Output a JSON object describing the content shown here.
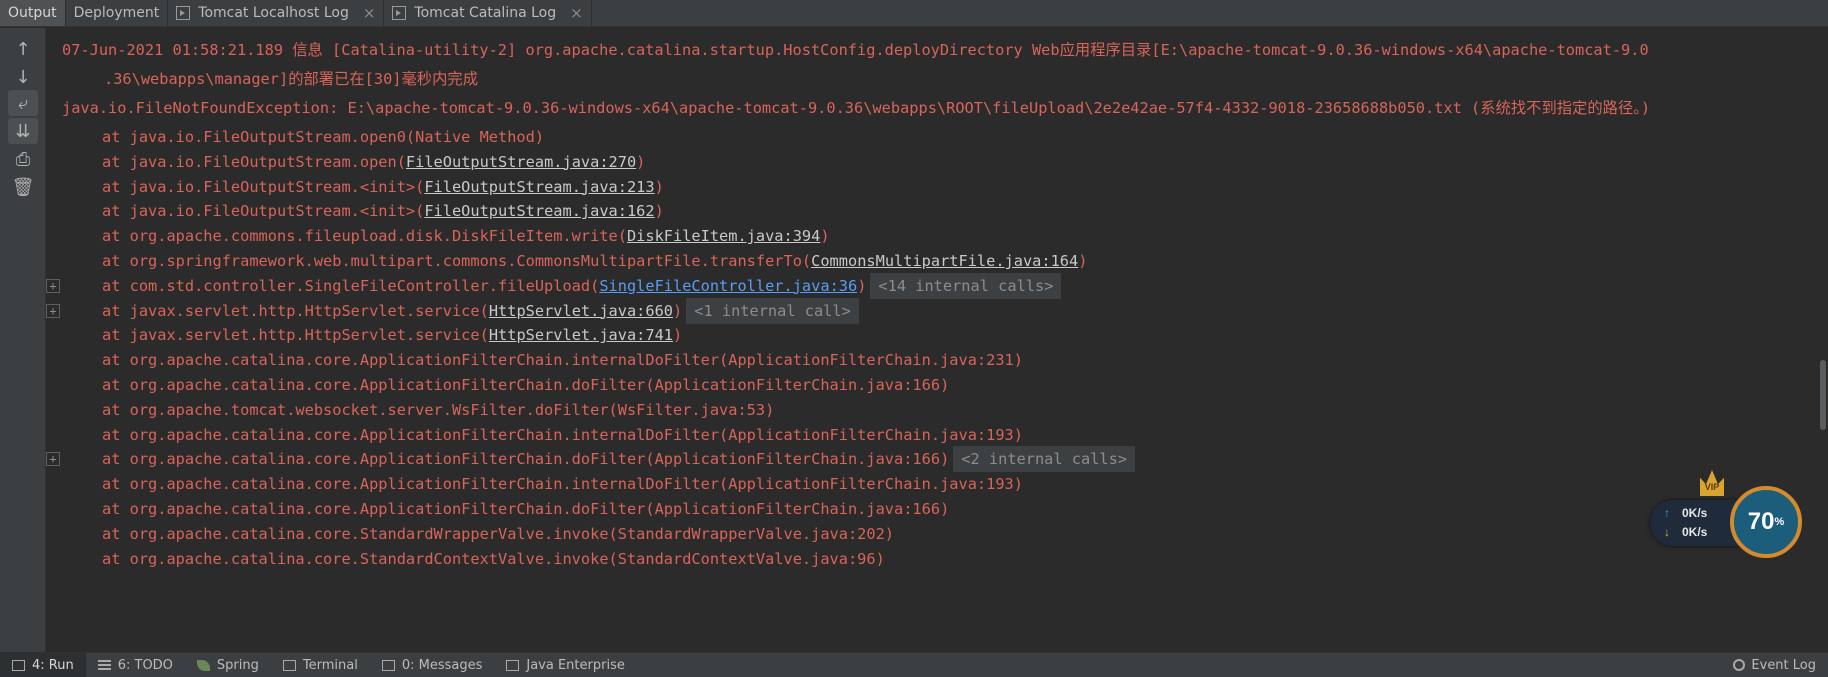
{
  "tabs": [
    {
      "label": "Output",
      "active": true,
      "icon": "",
      "closable": false
    },
    {
      "label": "Deployment",
      "active": false,
      "icon": "",
      "closable": false
    },
    {
      "label": "Tomcat Localhost Log",
      "active": false,
      "icon": "log-icon",
      "closable": true
    },
    {
      "label": "Tomcat Catalina Log",
      "active": false,
      "icon": "log-icon",
      "closable": true
    }
  ],
  "close_glyph": "×",
  "toolbar": {
    "up_glyph": "↑",
    "down_glyph": "↓",
    "wrap_glyph": "⤶",
    "scroll_glyph": "⇊",
    "print_glyph": "⎙",
    "clear_glyph": "🗑"
  },
  "console": {
    "head_line1": "07-Jun-2021 01:58:21.189 信息 [Catalina-utility-2] org.apache.catalina.startup.HostConfig.deployDirectory Web应用程序目录[E:\\apache-tomcat-9.0.36-windows-x64\\apache-tomcat-9.0",
    "head_line2": ".36\\webapps\\manager]的部署已在[30]毫秒内完成",
    "exception_line": "java.io.FileNotFoundException: E:\\apache-tomcat-9.0.36-windows-x64\\apache-tomcat-9.0.36\\webapps\\ROOT\\fileUpload\\2e2e42ae-57f4-4332-9018-23658688b050.txt (系统找不到指定的路径。)",
    "fold_glyph": "+",
    "frames": [
      {
        "text": "at java.io.FileOutputStream.open0(Native Method)",
        "link": "",
        "suffix": "",
        "internal": "",
        "blue": false,
        "fold": false
      },
      {
        "text": "at java.io.FileOutputStream.open(",
        "link": "FileOutputStream.java:270",
        "suffix": ")",
        "internal": "",
        "blue": false,
        "fold": false
      },
      {
        "text": "at java.io.FileOutputStream.<init>(",
        "link": "FileOutputStream.java:213",
        "suffix": ")",
        "internal": "",
        "blue": false,
        "fold": false
      },
      {
        "text": "at java.io.FileOutputStream.<init>(",
        "link": "FileOutputStream.java:162",
        "suffix": ")",
        "internal": "",
        "blue": false,
        "fold": false
      },
      {
        "text": "at org.apache.commons.fileupload.disk.DiskFileItem.write(",
        "link": "DiskFileItem.java:394",
        "suffix": ")",
        "internal": "",
        "blue": false,
        "fold": false
      },
      {
        "text": "at org.springframework.web.multipart.commons.CommonsMultipartFile.transferTo(",
        "link": "CommonsMultipartFile.java:164",
        "suffix": ")",
        "internal": "",
        "blue": false,
        "fold": false
      },
      {
        "text": "at com.std.controller.SingleFileController.fileUpload(",
        "link": "SingleFileController.java:36",
        "suffix": ")",
        "internal": "<14 internal calls>",
        "blue": true,
        "fold": true
      },
      {
        "text": "at javax.servlet.http.HttpServlet.service(",
        "link": "HttpServlet.java:660",
        "suffix": ")",
        "internal": "<1 internal call>",
        "blue": false,
        "fold": true
      },
      {
        "text": "at javax.servlet.http.HttpServlet.service(",
        "link": "HttpServlet.java:741",
        "suffix": ")",
        "internal": "",
        "blue": false,
        "fold": false
      },
      {
        "text": "at org.apache.catalina.core.ApplicationFilterChain.internalDoFilter(ApplicationFilterChain.java:231)",
        "link": "",
        "suffix": "",
        "internal": "",
        "blue": false,
        "fold": false
      },
      {
        "text": "at org.apache.catalina.core.ApplicationFilterChain.doFilter(ApplicationFilterChain.java:166)",
        "link": "",
        "suffix": "",
        "internal": "",
        "blue": false,
        "fold": false
      },
      {
        "text": "at org.apache.tomcat.websocket.server.WsFilter.doFilter(WsFilter.java:53)",
        "link": "",
        "suffix": "",
        "internal": "",
        "blue": false,
        "fold": false
      },
      {
        "text": "at org.apache.catalina.core.ApplicationFilterChain.internalDoFilter(ApplicationFilterChain.java:193)",
        "link": "",
        "suffix": "",
        "internal": "",
        "blue": false,
        "fold": false
      },
      {
        "text": "at org.apache.catalina.core.ApplicationFilterChain.doFilter(ApplicationFilterChain.java:166)",
        "link": "",
        "suffix": "",
        "internal": "<2 internal calls>",
        "blue": false,
        "fold": true
      },
      {
        "text": "at org.apache.catalina.core.ApplicationFilterChain.internalDoFilter(ApplicationFilterChain.java:193)",
        "link": "",
        "suffix": "",
        "internal": "",
        "blue": false,
        "fold": false
      },
      {
        "text": "at org.apache.catalina.core.ApplicationFilterChain.doFilter(ApplicationFilterChain.java:166)",
        "link": "",
        "suffix": "",
        "internal": "",
        "blue": false,
        "fold": false
      },
      {
        "text": "at org.apache.catalina.core.StandardWrapperValve.invoke(StandardWrapperValve.java:202)",
        "link": "",
        "suffix": "",
        "internal": "",
        "blue": false,
        "fold": false
      },
      {
        "text": "at org.apache.catalina.core.StandardContextValve.invoke(StandardContextValve.java:96)",
        "link": "",
        "suffix": "",
        "internal": "",
        "blue": false,
        "fold": false
      }
    ]
  },
  "statusbar": {
    "items": [
      {
        "label": "4: Run",
        "icon": "run-icon",
        "active": true
      },
      {
        "label": "6: TODO",
        "icon": "todo-icon",
        "active": false
      },
      {
        "label": "Spring",
        "icon": "spring-icon",
        "active": false
      },
      {
        "label": "Terminal",
        "icon": "terminal-icon",
        "active": false
      },
      {
        "label": "0: Messages",
        "icon": "messages-icon",
        "active": false
      },
      {
        "label": "Java Enterprise",
        "icon": "java-enterprise-icon",
        "active": false
      }
    ],
    "event_log": "Event Log"
  },
  "net_widget": {
    "vip": "VIP",
    "up_arrow": "↑",
    "down_arrow": "↓",
    "upload": "0K/s",
    "download": "0K/s",
    "percent": "70",
    "percent_unit": "%"
  },
  "colors": {
    "error_text": "#d8645a",
    "link_blue": "#589df6",
    "background": "#2b2b2b"
  }
}
